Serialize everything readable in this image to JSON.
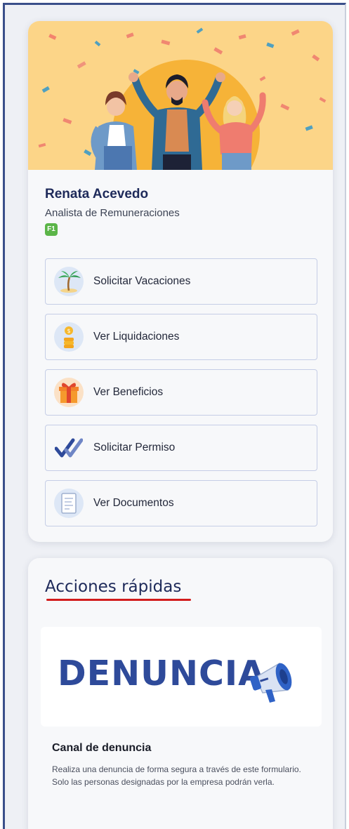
{
  "profile": {
    "name": "Renata Acevedo",
    "role": "Analista de Remuneraciones",
    "badge": "F1"
  },
  "actions": [
    {
      "label": "Solicitar Vacaciones",
      "icon": "palm-tree-icon"
    },
    {
      "label": "Ver Liquidaciones",
      "icon": "coins-icon"
    },
    {
      "label": "Ver Beneficios",
      "icon": "gift-icon"
    },
    {
      "label": "Solicitar Permiso",
      "icon": "double-check-icon"
    },
    {
      "label": "Ver Documentos",
      "icon": "document-icon"
    }
  ],
  "quick_actions": {
    "title": "Acciones rápidas",
    "banner_word": "DENUNCIA",
    "channel_title": "Canal de denuncia",
    "channel_description": "Realiza una denuncia de forma segura a través de este formulario. Solo las personas designadas por la empresa podrán verla."
  },
  "colors": {
    "accent": "#2e4a9a",
    "banner": "#fcd588",
    "underline": "#d21c1c",
    "badge": "#5bb548"
  }
}
